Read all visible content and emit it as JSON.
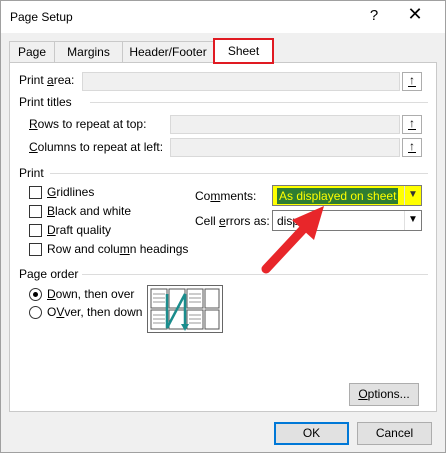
{
  "window": {
    "title": "Page Setup",
    "help_glyph": "?",
    "close_glyph": "✕"
  },
  "tabs": [
    {
      "label": "Page",
      "active": false
    },
    {
      "label": "Margins",
      "active": false
    },
    {
      "label": "Header/Footer",
      "active": false
    },
    {
      "label": "Sheet",
      "active": true
    }
  ],
  "print_area": {
    "label_pre": "Print ",
    "label_u": "a",
    "label_post": "rea:",
    "value": ""
  },
  "print_titles": {
    "heading": "Print titles",
    "rows": {
      "label_u": "R",
      "label_rest": "ows to repeat at top:",
      "value": ""
    },
    "cols": {
      "label_u": "C",
      "label_rest": "olumns to repeat at left:",
      "value": ""
    }
  },
  "print": {
    "heading": "Print",
    "options": [
      {
        "u": "G",
        "rest": "ridlines",
        "checked": false
      },
      {
        "u": "B",
        "rest": "lack and white",
        "checked": false
      },
      {
        "u": "D",
        "rest": "raft quality",
        "checked": false
      },
      {
        "pre": "Row and colu",
        "u": "m",
        "rest": "n headings",
        "checked": false
      }
    ],
    "comments": {
      "label_pre": "Co",
      "label_u": "m",
      "label_post": "ments:",
      "value": "As displayed on sheet"
    },
    "cell_errors": {
      "label_pre": "Cell ",
      "label_u": "e",
      "label_post": "rrors as:",
      "value": "displ"
    }
  },
  "page_order": {
    "heading": "Page order",
    "options": [
      {
        "u": "D",
        "rest": "own, then over",
        "selected": true
      },
      {
        "u": "V",
        "rest": "ver, then down",
        "pre": "O",
        "selected": false
      }
    ]
  },
  "buttons": {
    "options_pre": "",
    "options_u": "O",
    "options_rest": "ptions...",
    "ok": "OK",
    "cancel": "Cancel"
  },
  "annotation": {
    "highlight_tab": "#e01a22",
    "arrow_color": "#e8262a",
    "highlight_field": "#ffff00"
  }
}
